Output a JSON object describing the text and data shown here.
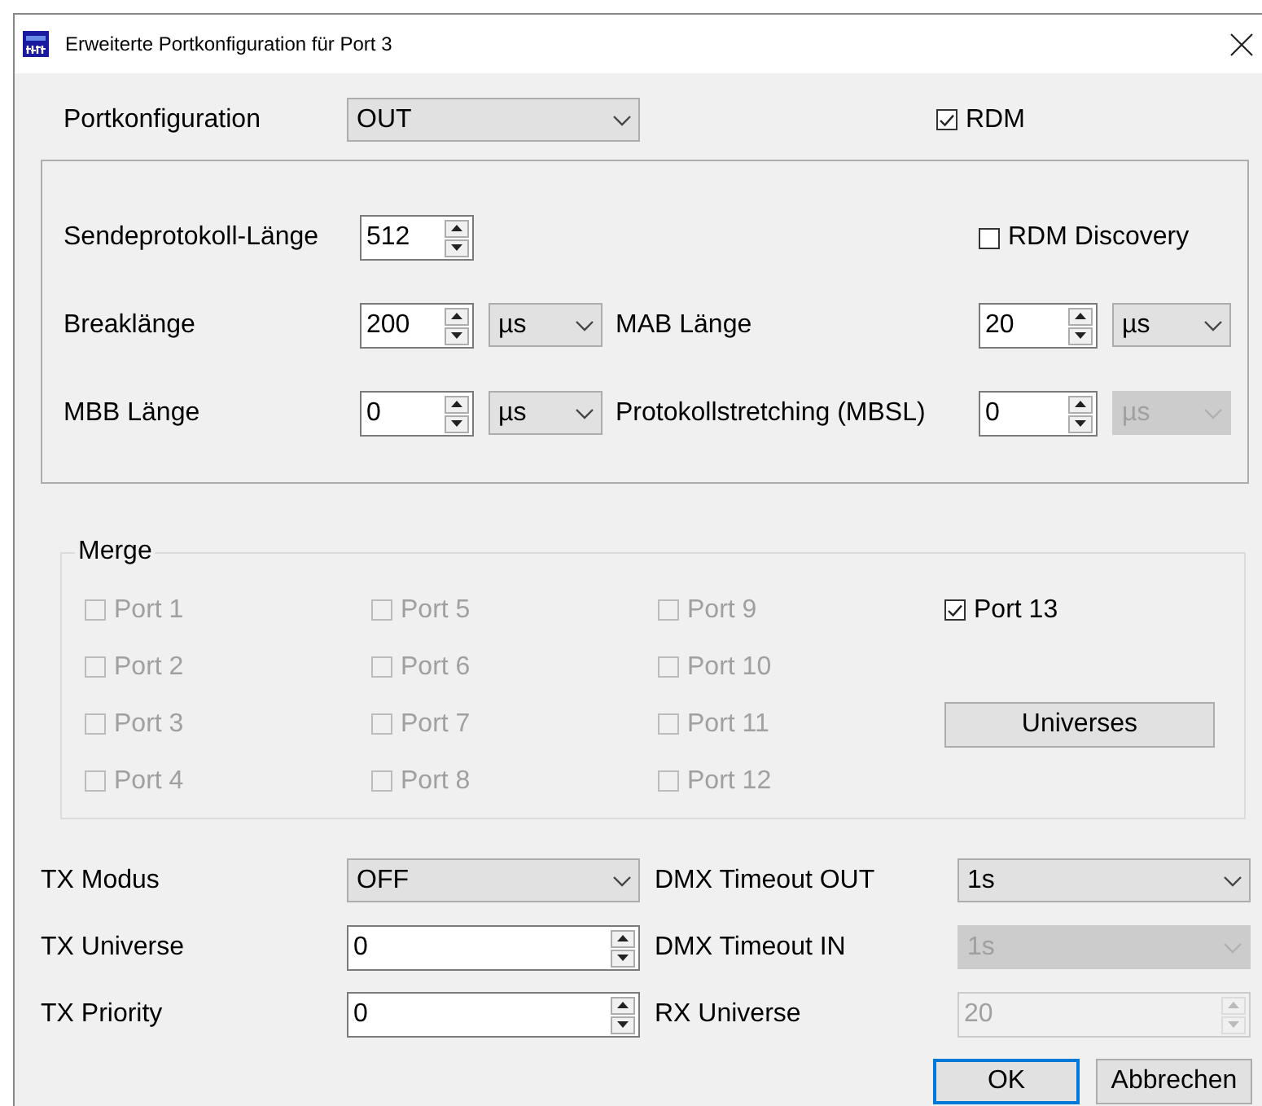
{
  "window": {
    "title": "Erweiterte Portkonfiguration für Port 3"
  },
  "port_configuration": {
    "label": "Portkonfiguration",
    "value": "OUT"
  },
  "rdm": {
    "label": "RDM",
    "checked": true
  },
  "protocol": {
    "length_label": "Sendeprotokoll-Länge",
    "length_value": "512",
    "rdm_discovery": {
      "label": "RDM Discovery",
      "checked": false
    },
    "fields": [
      {
        "label": "Breaklänge",
        "value": "200",
        "unit": "µs",
        "unit_disabled": false
      },
      {
        "label": "MAB Länge",
        "value": "20",
        "unit": "µs",
        "unit_disabled": false
      },
      {
        "label": "MBB Länge",
        "value": "0",
        "unit": "µs",
        "unit_disabled": false
      },
      {
        "label": "Protokollstretching (MBSL)",
        "value": "0",
        "unit": "µs",
        "unit_disabled": true
      }
    ]
  },
  "merge": {
    "title": "Merge",
    "button": "Universes",
    "ports": [
      {
        "label": "Port 1",
        "checked": false,
        "disabled": true
      },
      {
        "label": "Port 2",
        "checked": false,
        "disabled": true
      },
      {
        "label": "Port 3",
        "checked": false,
        "disabled": true
      },
      {
        "label": "Port 4",
        "checked": false,
        "disabled": true
      },
      {
        "label": "Port 5",
        "checked": false,
        "disabled": true
      },
      {
        "label": "Port 6",
        "checked": false,
        "disabled": true
      },
      {
        "label": "Port 7",
        "checked": false,
        "disabled": true
      },
      {
        "label": "Port 8",
        "checked": false,
        "disabled": true
      },
      {
        "label": "Port 9",
        "checked": false,
        "disabled": true
      },
      {
        "label": "Port 10",
        "checked": false,
        "disabled": true
      },
      {
        "label": "Port 11",
        "checked": false,
        "disabled": true
      },
      {
        "label": "Port 12",
        "checked": false,
        "disabled": true
      },
      {
        "label": "Port 13",
        "checked": true,
        "disabled": false
      }
    ]
  },
  "bottom_left": [
    {
      "kind": "combo",
      "label": "TX Modus",
      "value": "OFF",
      "disabled": false
    },
    {
      "kind": "spin",
      "label": "TX Universe",
      "value": "0",
      "disabled": false
    },
    {
      "kind": "spin",
      "label": "TX Priority",
      "value": "0",
      "disabled": false
    }
  ],
  "bottom_right": [
    {
      "kind": "combo",
      "label": "DMX Timeout OUT",
      "value": "1s",
      "disabled": false
    },
    {
      "kind": "combo",
      "label": "DMX Timeout IN",
      "value": "1s",
      "disabled": true
    },
    {
      "kind": "spin",
      "label": "RX Universe",
      "value": "20",
      "disabled": true
    }
  ],
  "buttons": [
    {
      "label": "OK",
      "default": true
    },
    {
      "label": "Abbrechen",
      "default": false
    }
  ]
}
